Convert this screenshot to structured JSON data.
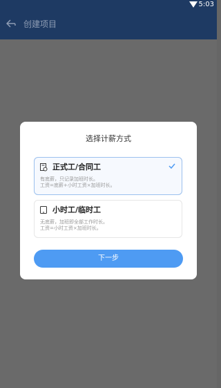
{
  "status_bar": {
    "time": "5:03"
  },
  "app_bar": {
    "title": "创建项目"
  },
  "dialog": {
    "title": "选择计薪方式",
    "options": [
      {
        "title": "正式工/合同工",
        "line1": "有底薪，只记录加班时长。",
        "line2": "工资=底薪+小时工资×加班时长。",
        "selected": true
      },
      {
        "title": "小时工/临时工",
        "line1": "无底薪，加班即全部工作时长。",
        "line2": "工资=小时工资×加班时长。",
        "selected": false
      }
    ],
    "next_button": "下一步"
  },
  "colors": {
    "app_bar": "#1e3a63",
    "accent": "#4e9bf3",
    "selected_border": "#9bc0ee"
  }
}
